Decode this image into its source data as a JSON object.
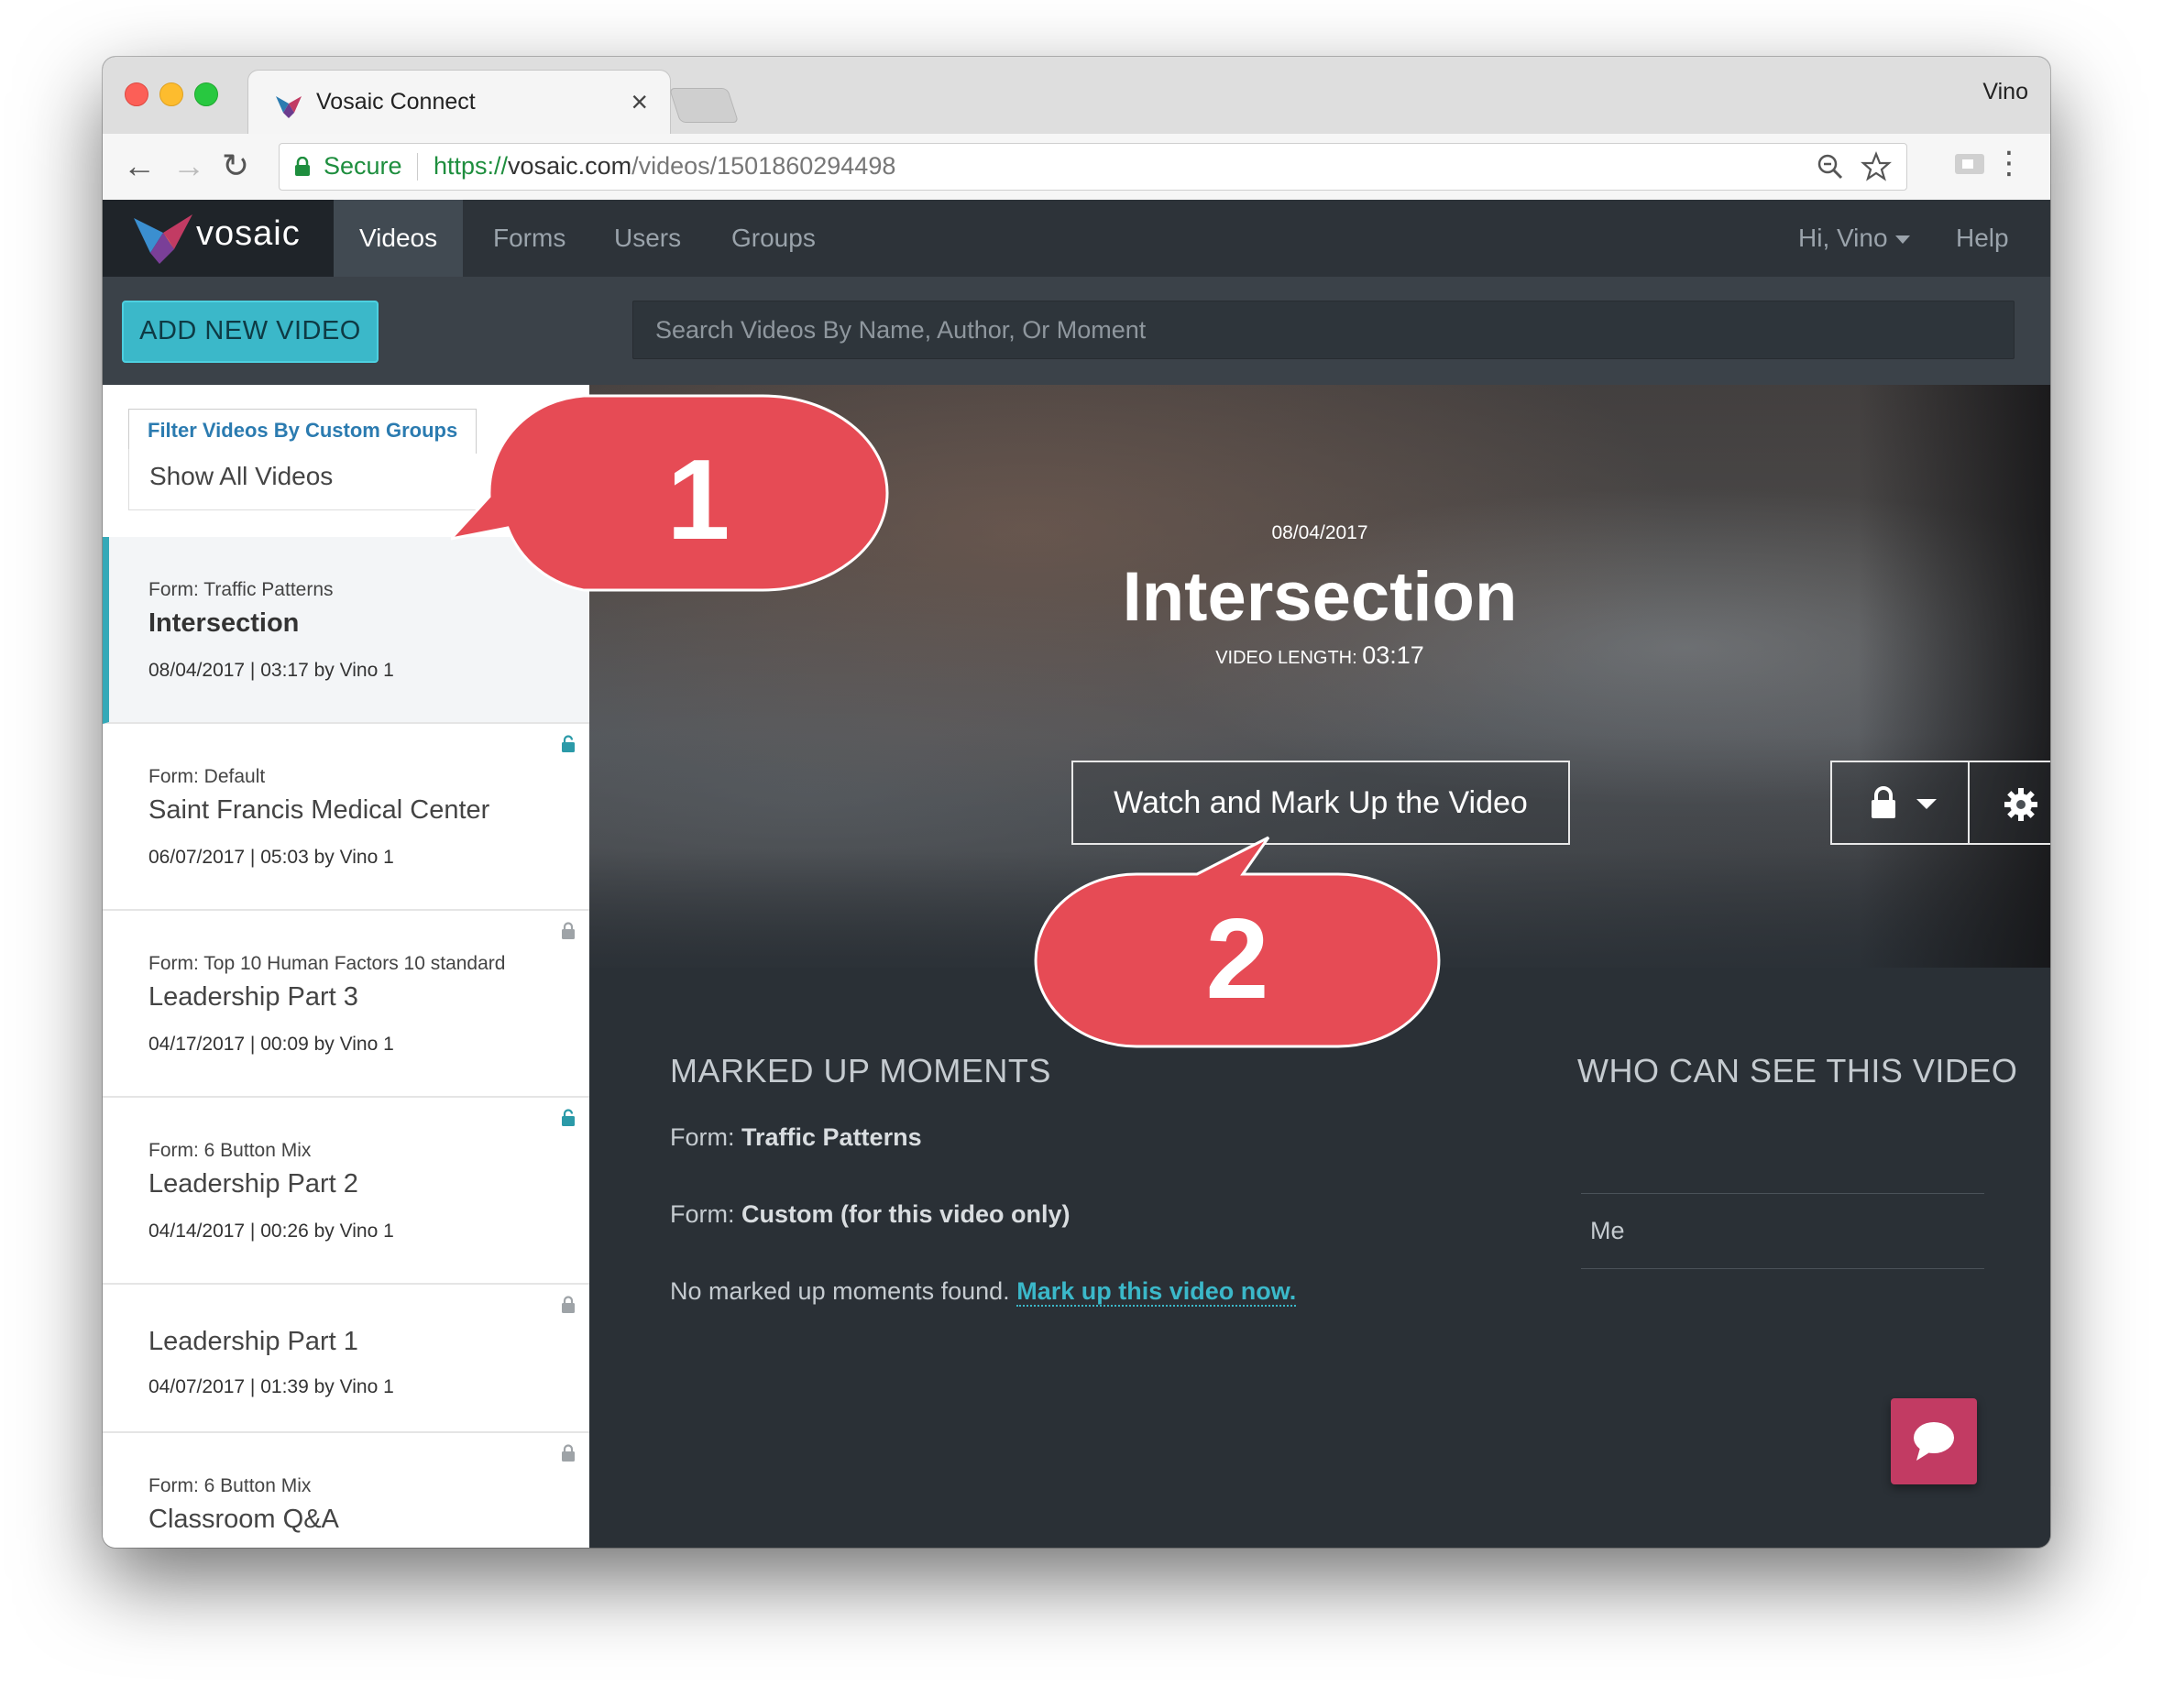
{
  "browser": {
    "tab_title": "Vosaic Connect",
    "tab_close": "×",
    "profile_name": "Vino",
    "secure_label": "Secure",
    "url_scheme": "https://",
    "url_host": "vosaic.com",
    "url_path": "/videos/1501860294498",
    "back": "←",
    "forward": "→",
    "reload": "↻",
    "menu": "⋮"
  },
  "nav": {
    "brand": "vosaic",
    "links": [
      "Videos",
      "Forms",
      "Users",
      "Groups"
    ],
    "active": "Videos",
    "user_greeting": "Hi, Vino",
    "help": "Help"
  },
  "actions": {
    "add_video_label": "ADD NEW VIDEO",
    "search_placeholder": "Search Videos By Name, Author, Or Moment"
  },
  "filter": {
    "label": "Filter Videos By Custom Groups",
    "selected": "Show All Videos"
  },
  "videos": [
    {
      "form": "Form: Traffic Patterns",
      "title": "Intersection",
      "meta": "08/04/2017 | 03:17 by Vino 1",
      "lock": "locked",
      "selected": true
    },
    {
      "form": "Form: Default",
      "title": "Saint Francis Medical Center",
      "meta": "06/07/2017 | 05:03 by Vino 1",
      "lock": "unlocked"
    },
    {
      "form": "Form: Top 10 Human Factors 10 standard",
      "title": "Leadership Part 3",
      "meta": "04/17/2017 | 00:09 by Vino 1",
      "lock": "locked"
    },
    {
      "form": "Form: 6 Button Mix",
      "title": "Leadership Part 2",
      "meta": "04/14/2017 | 00:26 by Vino 1",
      "lock": "unlocked"
    },
    {
      "form": "",
      "title": "Leadership Part 1",
      "meta": "04/07/2017 | 01:39 by Vino 1",
      "lock": "locked"
    },
    {
      "form": "Form: 6 Button Mix",
      "title": "Classroom Q&A",
      "meta": "",
      "lock": "locked"
    }
  ],
  "hero": {
    "date": "08/04/2017",
    "title": "Intersection",
    "length_label": "VIDEO LENGTH:",
    "length_value": "03:17",
    "watch_button": "Watch and Mark Up the Video"
  },
  "details": {
    "moments_heading": "MARKED UP MOMENTS",
    "form_prefix": "Form:",
    "form1": "Traffic Patterns",
    "form2": "Custom (for this video only)",
    "no_moments": "No marked up moments found.",
    "mark_link": "Mark up this video now.",
    "who_heading": "WHO CAN SEE THIS VIDEO",
    "who_items": [
      "Me"
    ]
  },
  "callouts": {
    "one": "1",
    "two": "2"
  },
  "colors": {
    "accent": "#3bb8c9",
    "callout_red": "#e64b55",
    "chat": "#c23b63",
    "nav_bg": "#2d3339",
    "secure_green": "#1e8e3e"
  }
}
